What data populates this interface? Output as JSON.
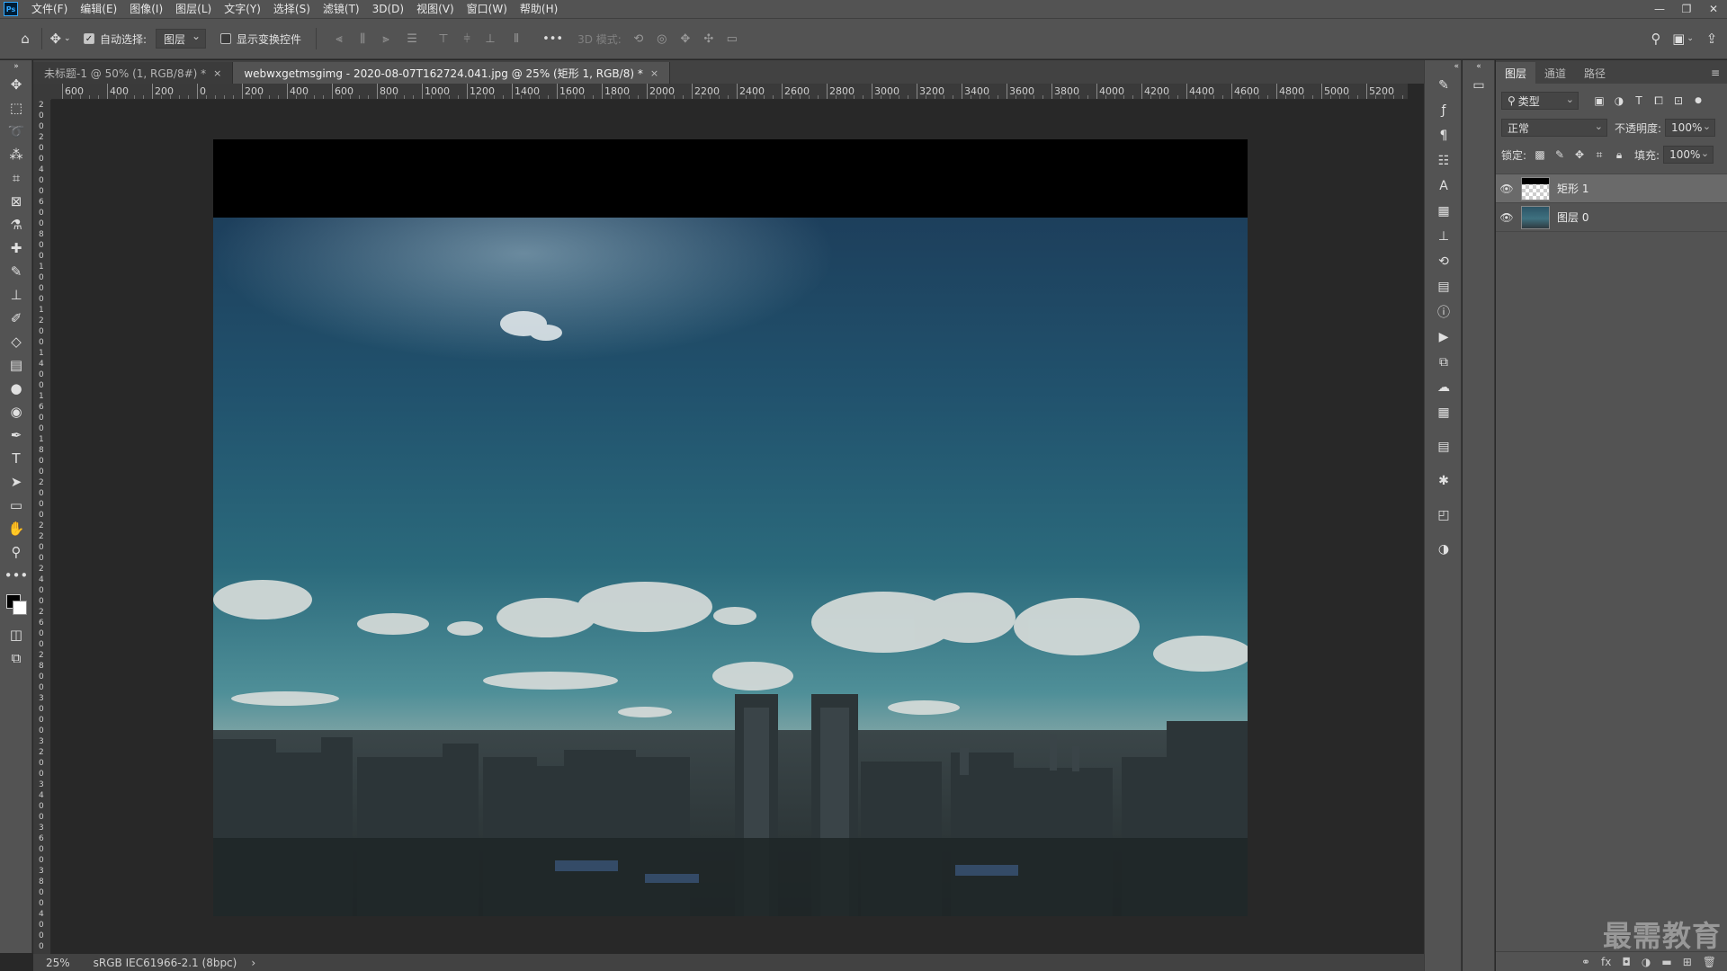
{
  "menubar": {
    "logo": "Ps",
    "items": [
      "文件(F)",
      "编辑(E)",
      "图像(I)",
      "图层(L)",
      "文字(Y)",
      "选择(S)",
      "滤镜(T)",
      "3D(D)",
      "视图(V)",
      "窗口(W)",
      "帮助(H)"
    ],
    "window_controls": [
      "—",
      "❐",
      "✕"
    ]
  },
  "options": {
    "auto_select_label": "自动选择:",
    "auto_select_checked": true,
    "auto_select_value": "图层",
    "show_transform_label": "显示变换控件",
    "show_transform_checked": false,
    "more": "•••",
    "mode_3d_label": "3D 模式:"
  },
  "tabs": [
    {
      "title": "未标题-1 @ 50% (1, RGB/8#) *",
      "active": false
    },
    {
      "title": "webwxgetmsgimg - 2020-08-07T162724.041.jpg @ 25% (矩形 1, RGB/8) *",
      "active": true
    }
  ],
  "ruler": {
    "top_labels": [
      "600",
      "400",
      "200",
      "0",
      "200",
      "400",
      "600",
      "800",
      "1000",
      "1200",
      "1400",
      "1600",
      "1800",
      "2000",
      "2200",
      "2400",
      "2600",
      "2800",
      "3000",
      "3200",
      "3400",
      "3600",
      "3800",
      "4000",
      "4200",
      "4400",
      "4600",
      "4800",
      "5000",
      "5200"
    ],
    "left_labels": [
      "2",
      "0",
      "0",
      "2",
      "0",
      "0",
      "4",
      "0",
      "0",
      "6",
      "0",
      "0",
      "8",
      "0",
      "0",
      "1",
      "0",
      "0",
      "0",
      "1",
      "2",
      "0",
      "0",
      "1",
      "4",
      "0",
      "0",
      "1",
      "6",
      "0",
      "0",
      "1",
      "8",
      "0",
      "0",
      "2",
      "0",
      "0",
      "0",
      "2",
      "2",
      "0",
      "0",
      "2",
      "4",
      "0",
      "0",
      "2",
      "6",
      "0",
      "0",
      "2",
      "8",
      "0",
      "0",
      "3",
      "0",
      "0",
      "0",
      "3",
      "2",
      "0",
      "0",
      "3",
      "4",
      "0",
      "0",
      "3",
      "6",
      "0",
      "0",
      "3",
      "8",
      "0",
      "0",
      "4",
      "0",
      "0",
      "0"
    ]
  },
  "status": {
    "zoom": "25%",
    "profile": "sRGB IEC61966-2.1 (8bpc)",
    "arrow": "›"
  },
  "layers_panel": {
    "tabs": [
      "图层",
      "通道",
      "路径"
    ],
    "filter_type": "类型",
    "blend_mode": "正常",
    "opacity_label": "不透明度:",
    "opacity_value": "100%",
    "lock_label": "锁定:",
    "fill_label": "填充:",
    "fill_value": "100%",
    "layers": [
      {
        "name": "矩形 1",
        "visible": true,
        "selected": true
      },
      {
        "name": "图层 0",
        "visible": true,
        "selected": false
      }
    ]
  },
  "watermark": "最需教育"
}
